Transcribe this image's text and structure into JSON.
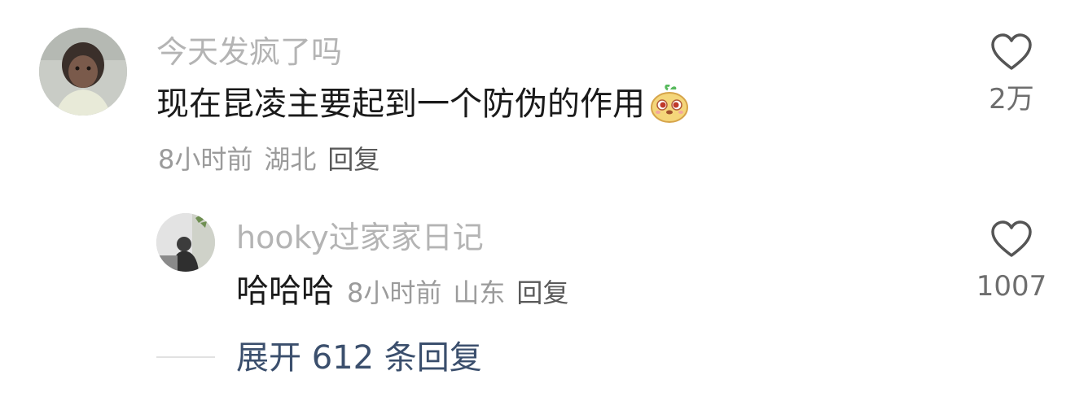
{
  "comment": {
    "username": "今天发疯了吗",
    "text": "现在昆凌主要起到一个防伪的作用",
    "emoji": "smirk-face-emoji",
    "time": "8小时前",
    "location": "湖北",
    "reply_label": "回复",
    "like_count": "2万"
  },
  "reply": {
    "username": "hooky过家家日记",
    "text": "哈哈哈",
    "time": "8小时前",
    "location": "山东",
    "reply_label": "回复",
    "like_count": "1007"
  },
  "expand": {
    "label": "展开 612 条回复"
  },
  "colors": {
    "username": "#b4b4b4",
    "body_text": "#1a1a1a",
    "meta": "#9b9b9b",
    "expand_link": "#3b4f6d",
    "heart_outline": "#555555"
  }
}
